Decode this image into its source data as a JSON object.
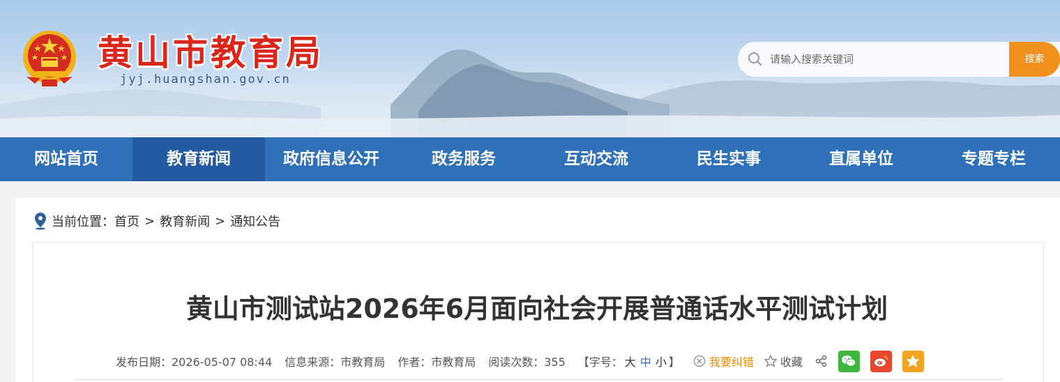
{
  "header": {
    "site_title": "黄山市教育局",
    "site_domain": "jyj.huangshan.gov.cn"
  },
  "search": {
    "placeholder": "请输入搜索关键词",
    "button_label": "搜索"
  },
  "nav": {
    "items": [
      {
        "label": "网站首页"
      },
      {
        "label": "教育新闻"
      },
      {
        "label": "政府信息公开"
      },
      {
        "label": "政务服务"
      },
      {
        "label": "互动交流"
      },
      {
        "label": "民生实事"
      },
      {
        "label": "直属单位"
      },
      {
        "label": "专题专栏"
      }
    ],
    "active_index": 1
  },
  "breadcrumb": {
    "prefix": "当前位置：",
    "items": [
      "首页",
      "教育新闻",
      "通知公告"
    ],
    "separator": ">"
  },
  "article": {
    "title": "黄山市测试站2026年6月面向社会开展普通话水平测试计划",
    "meta": {
      "publish_date": "发布日期：2026-05-07 08:44",
      "source": "信息来源：市教育局",
      "author": "作者：市教育局",
      "views": "阅读次数：355",
      "font_size_prefix": "【字号：",
      "font_large": "大",
      "font_medium": "中",
      "font_small": "小",
      "font_size_suffix": "】",
      "correction": "我要纠错",
      "favorite": "收藏"
    }
  },
  "colors": {
    "nav_bg": "#2f71b8",
    "nav_active": "#2359a0",
    "title_red": "#d9271b",
    "search_btn": "#f2901e",
    "correction_orange": "#f08a00"
  },
  "icons": [
    "national-emblem-icon",
    "search-icon",
    "location-pin-icon",
    "correction-icon",
    "star-icon",
    "share-icon",
    "wechat-icon",
    "weibo-icon",
    "qzone-icon"
  ]
}
